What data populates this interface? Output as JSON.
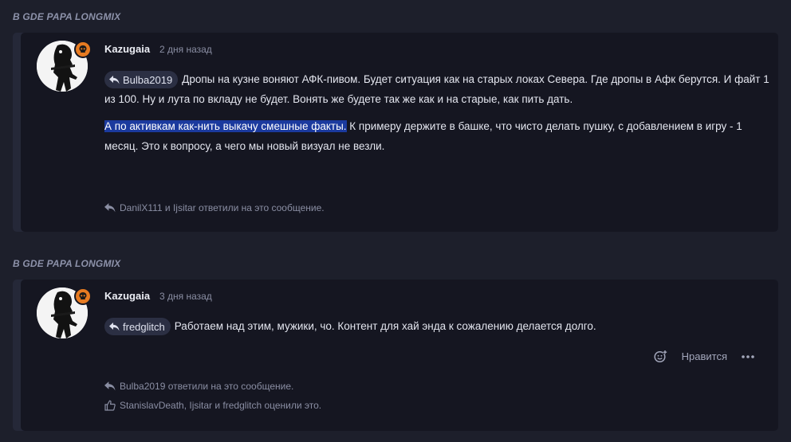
{
  "threads": [
    {
      "header": "В GDE PAPA LONGMIX",
      "author": "Kazugaia",
      "time": "2 дня назад",
      "mention": "Bulba2019",
      "paragraph1": "Дропы на кузне воняют АФК-пивом. Будет ситуация как на старых локах Севера. Где дропы в Афк берутся. И файт 1 из 100. Ну и лута по вкладу не будет. Вонять же будете так же как и на старые, как пить дать.",
      "paragraph2_highlight": "А по активкам как-нить выкачу смешные факты.",
      "paragraph2_rest": " К примеру держите в башке, что чисто делать пушку, с добавлением в игру - 1 месяц. Это к вопросу, а чего мы новый визуал не везли.",
      "replies_text": "DanilX111 и Ijsitar ответили на это сообщение."
    },
    {
      "header": "В GDE PAPA LONGMIX",
      "author": "Kazugaia",
      "time": "3 дня назад",
      "mention": "fredglitch",
      "paragraph1": "Работаем над этим, мужики, чо. Контент для хай энда к сожалению делается долго.",
      "like_label": "Нравится",
      "replies_text": "Bulba2019 ответили на это сообщение.",
      "likes_text": "StanislavDeath, Ijsitar и fredglitch оценили это."
    }
  ],
  "colors": {
    "background": "#1d1f2b",
    "card": "#252838",
    "post": "#151621",
    "badge": "#e77b21",
    "highlight": "#1b3a9e"
  }
}
